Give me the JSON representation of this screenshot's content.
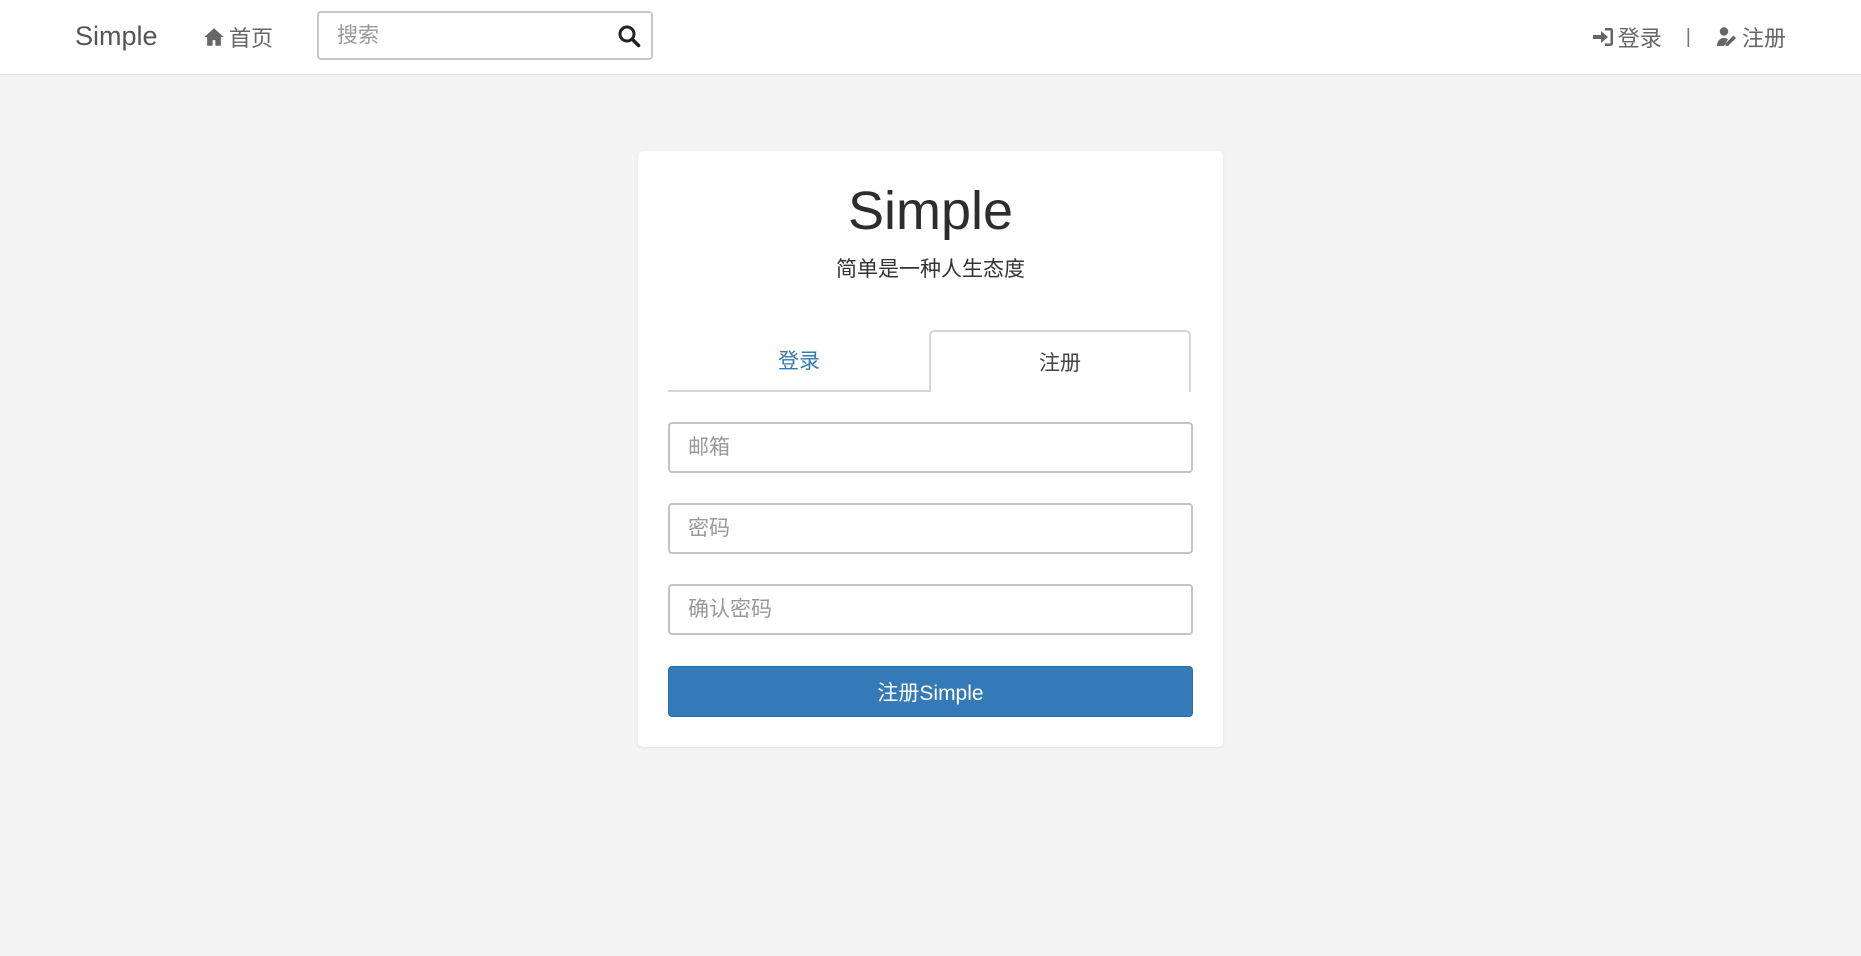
{
  "navbar": {
    "brand": "Simple",
    "home_icon": "home-icon",
    "home_label": "首页",
    "search_placeholder": "搜索",
    "search_icon": "search-icon",
    "login_icon": "sign-in-icon",
    "login_label": "登录",
    "separator": "|",
    "register_icon": "user-edit-icon",
    "register_label": "注册"
  },
  "card": {
    "title": "Simple",
    "subtitle": "简单是一种人生态度",
    "tabs": [
      {
        "label": "登录",
        "active": false
      },
      {
        "label": "注册",
        "active": true
      }
    ],
    "form": {
      "email_placeholder": "邮箱",
      "email_value": "",
      "password_placeholder": "密码",
      "password_value": "",
      "confirm_placeholder": "确认密码",
      "confirm_value": "",
      "submit_label": "注册Simple"
    }
  },
  "colors": {
    "primary": "#337ab7",
    "page_background": "#f3f4f3",
    "text": "#333333",
    "nav_text": "#666666"
  }
}
